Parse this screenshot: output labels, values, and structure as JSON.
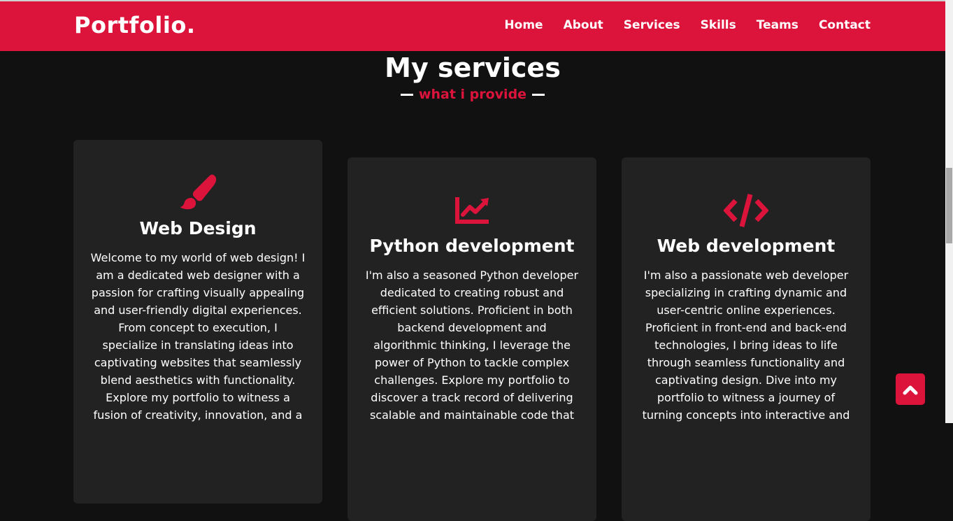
{
  "header": {
    "logo": "Portfolio.",
    "nav": [
      "Home",
      "About",
      "Services",
      "Skills",
      "Teams",
      "Contact"
    ]
  },
  "services": {
    "title": "My services",
    "subtitle": "what i provide",
    "cards": [
      {
        "icon": "paint-brush-icon",
        "title": "Web Design",
        "description": "Welcome to my world of web design! I am a dedicated web designer with a passion for crafting visually appealing and user-friendly digital experiences. From concept to execution, I specialize in translating ideas into captivating websites that seamlessly blend aesthetics with functionality. Explore my portfolio to witness a fusion of creativity, innovation, and a"
      },
      {
        "icon": "chart-line-icon",
        "title": "Python development",
        "description": "I'm also a seasoned Python developer dedicated to creating robust and efficient solutions. Proficient in both backend development and algorithmic thinking, I leverage the power of Python to tackle complex challenges. Explore my portfolio to discover a track record of delivering scalable and maintainable code that"
      },
      {
        "icon": "code-icon",
        "title": "Web development",
        "description": "I'm also a passionate web developer specializing in crafting dynamic and user-centric online experiences. Proficient in front-end and back-end technologies, I bring ideas to life through seamless functionality and captivating design. Dive into my portfolio to witness a journey of turning concepts into interactive and"
      }
    ]
  },
  "colors": {
    "accent": "#dc143c",
    "background": "#111111",
    "card": "#222222"
  },
  "scroll_top_icon": "chevron-up-icon"
}
